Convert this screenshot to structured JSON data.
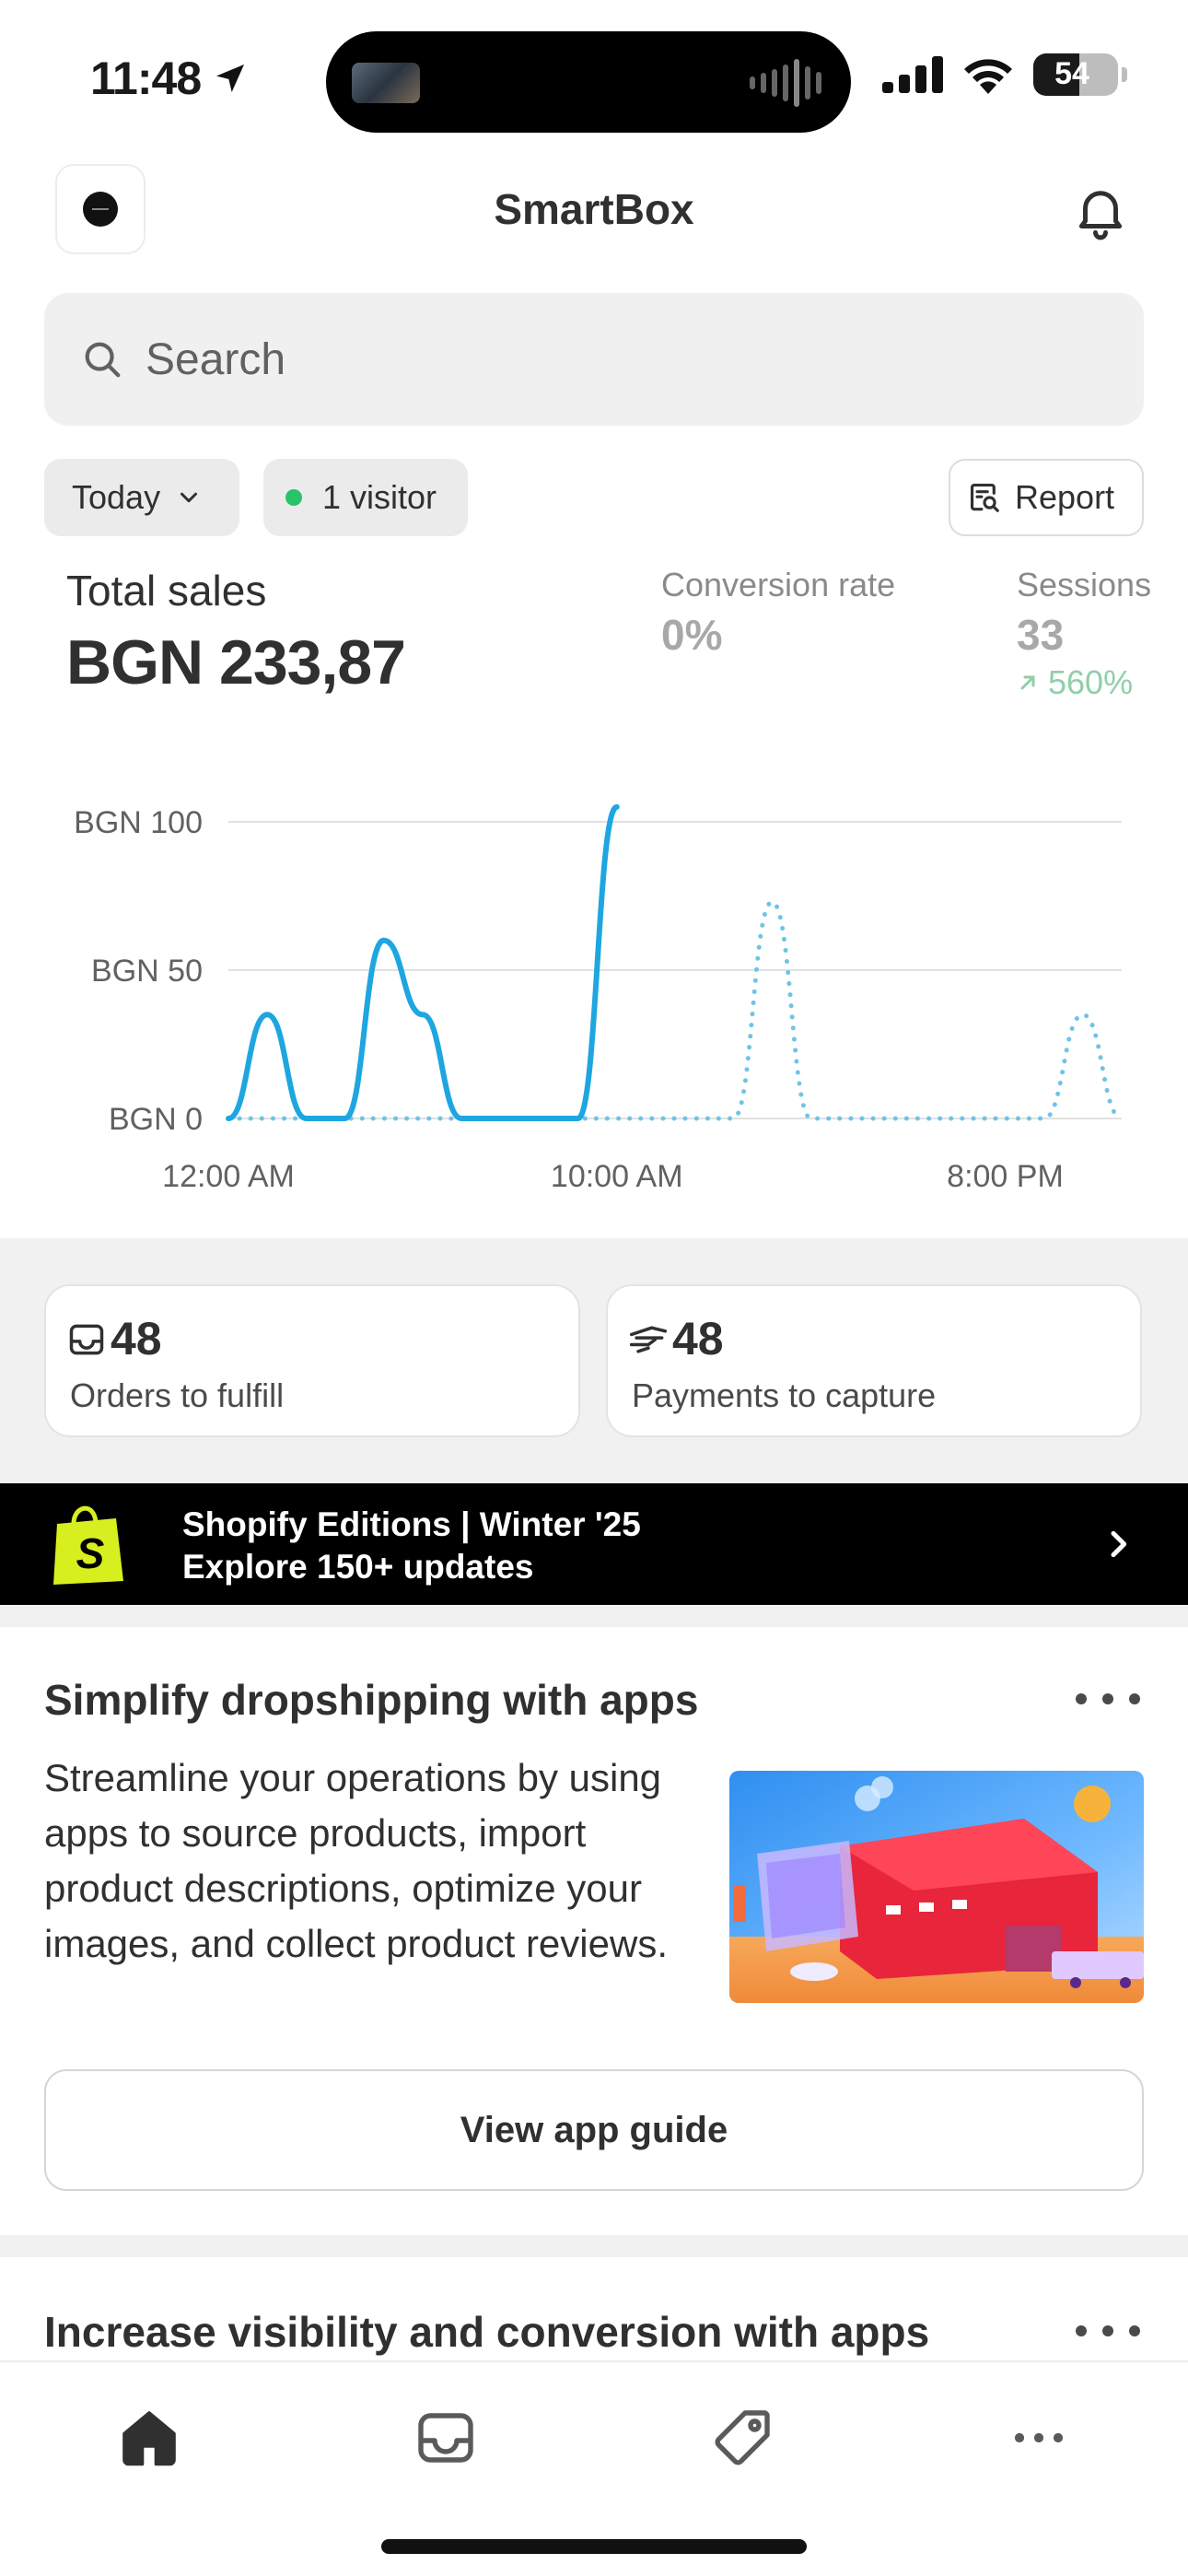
{
  "status_bar": {
    "time": "11:48",
    "battery": "54"
  },
  "header": {
    "title": "SmartBox"
  },
  "search": {
    "placeholder": "Search"
  },
  "filters": {
    "period": "Today",
    "visitors": "1 visitor",
    "report": "Report"
  },
  "metrics": {
    "total_sales_label": "Total sales",
    "total_sales_value": "BGN 233,87",
    "conversion_label": "Conversion rate",
    "conversion_value": "0%",
    "sessions_label": "Sessions",
    "sessions_value": "33",
    "sessions_delta": "560%"
  },
  "chart_data": {
    "type": "line",
    "y_ticks": [
      "BGN 100",
      "BGN 50",
      "BGN 0"
    ],
    "x_ticks": [
      "12:00 AM",
      "10:00 AM",
      "8:00 PM"
    ],
    "ylim": [
      0,
      100
    ],
    "x_hours": [
      0,
      1,
      2,
      3,
      4,
      5,
      6,
      7,
      8,
      9,
      10,
      11,
      12,
      13,
      14,
      15,
      16,
      17,
      18,
      19,
      20,
      21,
      22,
      23
    ],
    "series": [
      {
        "style": "solid",
        "color": "#1ea6e0",
        "values": [
          0,
          35,
          0,
          0,
          60,
          35,
          0,
          0,
          0,
          0,
          105
        ]
      },
      {
        "style": "dotted",
        "color": "#6fc4e6",
        "values": [
          0,
          0,
          0,
          0,
          0,
          0,
          0,
          0,
          0,
          0,
          0,
          0,
          0,
          0,
          73,
          0,
          0,
          0,
          0,
          0,
          0,
          0,
          35,
          0
        ]
      }
    ]
  },
  "stats": {
    "orders_count": "48",
    "orders_label": "Orders to fulfill",
    "payments_count": "48",
    "payments_label": "Payments to capture"
  },
  "promo": {
    "title": "Shopify Editions | Winter '25",
    "subtitle": "Explore 150+ updates"
  },
  "card1": {
    "title": "Simplify dropshipping with apps",
    "body": "Streamline your operations by using apps to source products, import product descriptions, optimize your images, and collect product reviews.",
    "button": "View app guide"
  },
  "card2": {
    "title": "Increase visibility and conversion with apps"
  },
  "tabs": {
    "icons": [
      "home-icon",
      "inbox-icon",
      "tag-icon",
      "more-icon"
    ]
  },
  "colors": {
    "chart_line": "#1ea6e0",
    "status_green": "#29c46a",
    "delta_green": "#8fcfa9",
    "promo_bg": "#000000",
    "brand_yellow": "#d8ef1f"
  }
}
